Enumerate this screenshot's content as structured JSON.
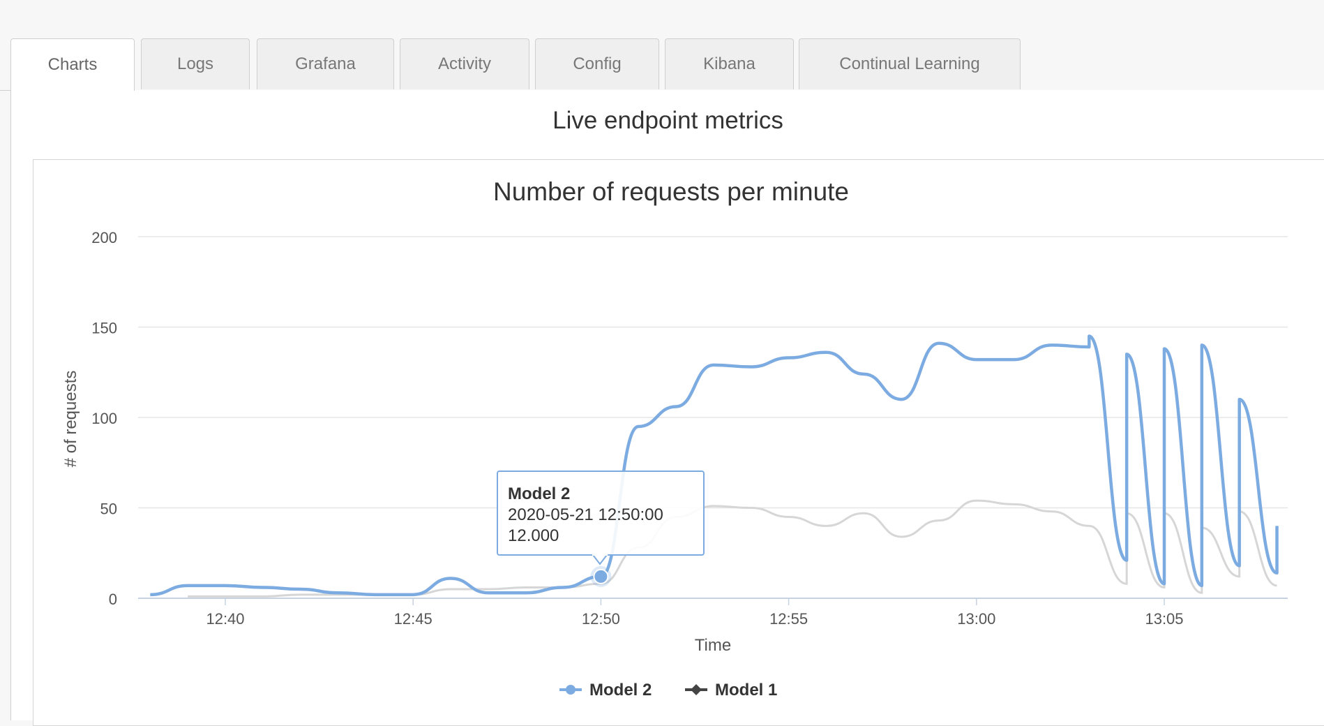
{
  "tabs": [
    {
      "label": "Charts",
      "active": true
    },
    {
      "label": "Logs",
      "active": false
    },
    {
      "label": "Grafana",
      "active": false
    },
    {
      "label": "Activity",
      "active": false
    },
    {
      "label": "Config",
      "active": false
    },
    {
      "label": "Kibana",
      "active": false
    },
    {
      "label": "Continual Learning",
      "active": false
    }
  ],
  "section_title": "Live endpoint metrics",
  "colors": {
    "model2": "#7cabe1",
    "model1": "#d6d6d6",
    "model1_legend": "#444444",
    "grid": "#e6e6e6"
  },
  "tooltip": {
    "series": "Model 2",
    "timestamp": "2020-05-21 12:50:00",
    "value": "12.000"
  },
  "chart_data": {
    "type": "line",
    "title": "Number of requests per minute",
    "xlabel": "Time",
    "ylabel": "# of requests",
    "x_axis": "time (minutes), 2020-05-21",
    "x_range": [
      "12:38",
      "13:08"
    ],
    "x_ticks": [
      "12:40",
      "12:45",
      "12:50",
      "12:55",
      "13:00",
      "13:05"
    ],
    "ylim": [
      0,
      200
    ],
    "y_ticks": [
      0,
      50,
      100,
      150,
      200
    ],
    "grid": true,
    "legend_position": "bottom-center",
    "series": [
      {
        "name": "Model 2",
        "marker": "circle",
        "points": [
          [
            "12:38",
            2
          ],
          [
            "12:39",
            7
          ],
          [
            "12:40",
            7
          ],
          [
            "12:41",
            6
          ],
          [
            "12:42",
            5
          ],
          [
            "12:43",
            3
          ],
          [
            "12:44",
            2
          ],
          [
            "12:45",
            2
          ],
          [
            "12:46",
            11
          ],
          [
            "12:47",
            3
          ],
          [
            "12:48",
            3
          ],
          [
            "12:49",
            6
          ],
          [
            "12:50",
            12
          ],
          [
            "12:51",
            95
          ],
          [
            "12:52",
            106
          ],
          [
            "12:53",
            129
          ],
          [
            "12:54",
            128
          ],
          [
            "12:55",
            133
          ],
          [
            "12:56",
            136
          ],
          [
            "12:57",
            124
          ],
          [
            "12:58",
            110
          ],
          [
            "12:59",
            141
          ],
          [
            "13:00",
            132
          ],
          [
            "13:01",
            132
          ],
          [
            "13:02",
            140
          ],
          [
            "13:03",
            139
          ],
          [
            "13:03",
            145
          ],
          [
            "13:04",
            21
          ],
          [
            "13:04",
            135
          ],
          [
            "13:05",
            8
          ],
          [
            "13:05",
            138
          ],
          [
            "13:06",
            7
          ],
          [
            "13:06",
            140
          ],
          [
            "13:07",
            18
          ],
          [
            "13:07",
            110
          ],
          [
            "13:08",
            14
          ],
          [
            "13:08",
            40
          ]
        ]
      },
      {
        "name": "Model 1",
        "marker": "diamond",
        "points": [
          [
            "12:39",
            1
          ],
          [
            "12:40",
            1
          ],
          [
            "12:41",
            1
          ],
          [
            "12:42",
            2
          ],
          [
            "12:43",
            2
          ],
          [
            "12:44",
            2
          ],
          [
            "12:45",
            2
          ],
          [
            "12:46",
            5
          ],
          [
            "12:47",
            5
          ],
          [
            "12:48",
            6
          ],
          [
            "12:49",
            6
          ],
          [
            "12:50",
            8
          ],
          [
            "12:51",
            28
          ],
          [
            "12:52",
            45
          ],
          [
            "12:53",
            51
          ],
          [
            "12:54",
            50
          ],
          [
            "12:55",
            45
          ],
          [
            "12:56",
            40
          ],
          [
            "12:57",
            47
          ],
          [
            "12:58",
            34
          ],
          [
            "12:59",
            43
          ],
          [
            "13:00",
            54
          ],
          [
            "13:01",
            52
          ],
          [
            "13:02",
            48
          ],
          [
            "13:03",
            40
          ],
          [
            "13:04",
            8
          ],
          [
            "13:04",
            47
          ],
          [
            "13:05",
            6
          ],
          [
            "13:05",
            47
          ],
          [
            "13:06",
            3
          ],
          [
            "13:06",
            39
          ],
          [
            "13:07",
            12
          ],
          [
            "13:07",
            48
          ],
          [
            "13:08",
            7
          ]
        ]
      }
    ]
  }
}
